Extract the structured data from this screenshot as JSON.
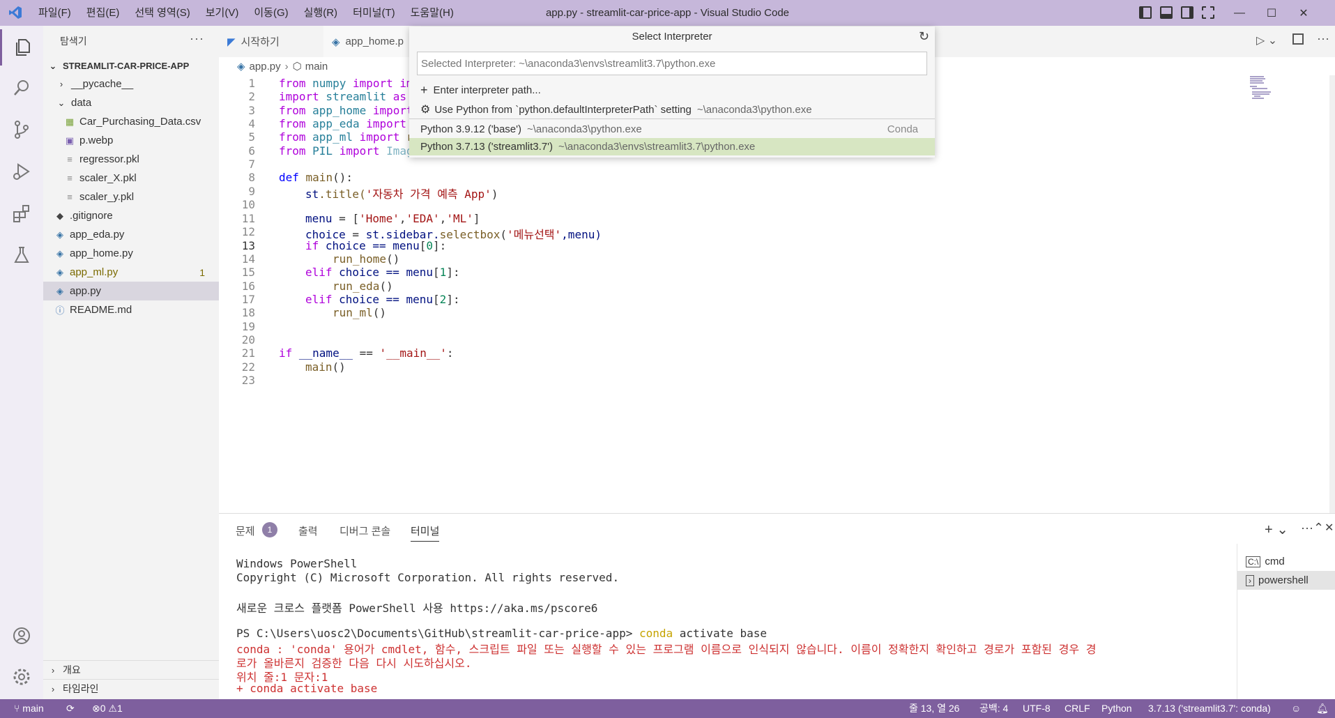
{
  "window": {
    "title": "app.py - streamlit-car-price-app - Visual Studio Code",
    "menu": [
      "파일(F)",
      "편집(E)",
      "선택 영역(S)",
      "보기(V)",
      "이동(G)",
      "실행(R)",
      "터미널(T)",
      "도움말(H)"
    ]
  },
  "sidebar": {
    "header": "탐색기",
    "more": "···",
    "project": "STREAMLIT-CAR-PRICE-APP",
    "items": [
      {
        "label": "__pycache__",
        "icon": "chevron-right-icon"
      },
      {
        "label": "data",
        "icon": "chevron-down-icon"
      },
      {
        "label": "Car_Purchasing_Data.csv",
        "icon": "csv-icon"
      },
      {
        "label": "p.webp",
        "icon": "image-icon"
      },
      {
        "label": "regressor.pkl",
        "icon": "file-icon"
      },
      {
        "label": "scaler_X.pkl",
        "icon": "file-icon"
      },
      {
        "label": "scaler_y.pkl",
        "icon": "file-icon"
      },
      {
        "label": ".gitignore",
        "icon": "git-icon"
      },
      {
        "label": "app_eda.py",
        "icon": "python-icon"
      },
      {
        "label": "app_home.py",
        "icon": "python-icon"
      },
      {
        "label": "app_ml.py",
        "icon": "python-icon",
        "badge": "1"
      },
      {
        "label": "app.py",
        "icon": "python-icon"
      },
      {
        "label": "README.md",
        "icon": "info-icon"
      }
    ],
    "outline": "개요",
    "timeline": "타임라인"
  },
  "tabs": [
    {
      "label": "시작하기"
    },
    {
      "label": "app_home.p"
    }
  ],
  "breadcrumb": {
    "file": "app.py",
    "symbol": "main"
  },
  "quickpick": {
    "title": "Select Interpreter",
    "placeholder": "Selected Interpreter: ~\\anaconda3\\envs\\streamlit3.7\\python.exe",
    "items": [
      {
        "label": "Enter interpreter path...",
        "icon": "plus-icon"
      },
      {
        "label": "Use Python from `python.defaultInterpreterPath` setting",
        "desc": "~\\anaconda3\\python.exe",
        "icon": "gear-icon"
      },
      {
        "label": "Python 3.9.12 ('base')",
        "desc": "~\\anaconda3\\python.exe",
        "right": "Conda"
      },
      {
        "label": "Python 3.7.13 ('streamlit3.7')",
        "desc": "~\\anaconda3\\envs\\streamlit3.7\\python.exe"
      }
    ]
  },
  "editor": {
    "line_numbers": [
      "1",
      "2",
      "3",
      "4",
      "5",
      "6",
      "7",
      "8",
      "9",
      "10",
      "11",
      "12",
      "13",
      "14",
      "15",
      "16",
      "17",
      "18",
      "19",
      "20",
      "21",
      "22",
      "23"
    ],
    "lines": {
      "l1": [
        "from",
        " numpy ",
        "import",
        " im"
      ],
      "l2": [
        "import",
        " streamlit ",
        "as"
      ],
      "l3": [
        "from",
        " app_home ",
        "import"
      ],
      "l4": [
        "from",
        " app_eda ",
        "import"
      ],
      "l5": [
        "from",
        " app_ml ",
        "import",
        " r"
      ],
      "l6": [
        "from",
        " PIL ",
        "import",
        " Image"
      ],
      "l8": [
        "def",
        " main",
        "():"
      ],
      "l9": [
        "st",
        ".title(",
        "'자동차 가격 예측 App'",
        ")"
      ],
      "l11": [
        "menu",
        " = [",
        "'Home'",
        ",",
        "'EDA'",
        ",",
        "'ML'",
        "]"
      ],
      "l12": [
        "choice",
        " = ",
        "st",
        ".sidebar.",
        "selectbox",
        "(",
        "'메뉴선택'",
        ",menu)"
      ],
      "l13": [
        "if",
        " choice == ",
        "menu",
        "[",
        "0",
        "]:"
      ],
      "l14": [
        "run_home",
        "()"
      ],
      "l15": [
        "elif",
        " choice == ",
        "menu",
        "[",
        "1",
        "]:"
      ],
      "l16": [
        "run_eda",
        "()"
      ],
      "l17": [
        "elif",
        " choice == ",
        "menu",
        "[",
        "2",
        "]:"
      ],
      "l18": [
        "run_ml",
        "()"
      ],
      "l21": [
        "if",
        " __name__ ",
        "==",
        " '__main__'",
        ":"
      ],
      "l22": [
        "main",
        "()"
      ]
    }
  },
  "panel": {
    "tabs": [
      "문제",
      "출력",
      "디버그 콘솔",
      "터미널"
    ],
    "problems_count": "1",
    "terminal_lines": [
      "Windows PowerShell",
      "Copyright (C) Microsoft Corporation. All rights reserved.",
      "",
      "새로운 크로스 플랫폼 PowerShell 사용 https://aka.ms/pscore6",
      "",
      "PS C:\\Users\\uosc2\\Documents\\GitHub\\streamlit-car-price-app> ",
      "conda : 'conda' 용어가 cmdlet, 함수, 스크립트 파일 또는 실행할 수 있는 프로그램 이름으로 인식되지 않습니다. 이름이 정확한지 확인하고 경로가 포함된 경우 경",
      "로가 올바른지 검증한 다음 다시 시도하십시오.",
      "위치 줄:1 문자:1",
      "+ conda activate base"
    ],
    "prompt_cmd": "conda",
    "prompt_args": " activate base",
    "terminals": [
      "cmd",
      "powershell"
    ]
  },
  "status": {
    "branch": "main",
    "errors": "0",
    "warnings": "1",
    "position": "줄 13, 열 26",
    "spaces": "공백: 4",
    "encoding": "UTF-8",
    "eol": "CRLF",
    "language": "Python",
    "interpreter": "3.7.13 ('streamlit3.7': conda)"
  },
  "colors": {
    "titlebar": "#c6b7da",
    "statusbar": "#7e5f9e",
    "selection": "#d7e6c2",
    "current_line": "#e5f2dc"
  }
}
